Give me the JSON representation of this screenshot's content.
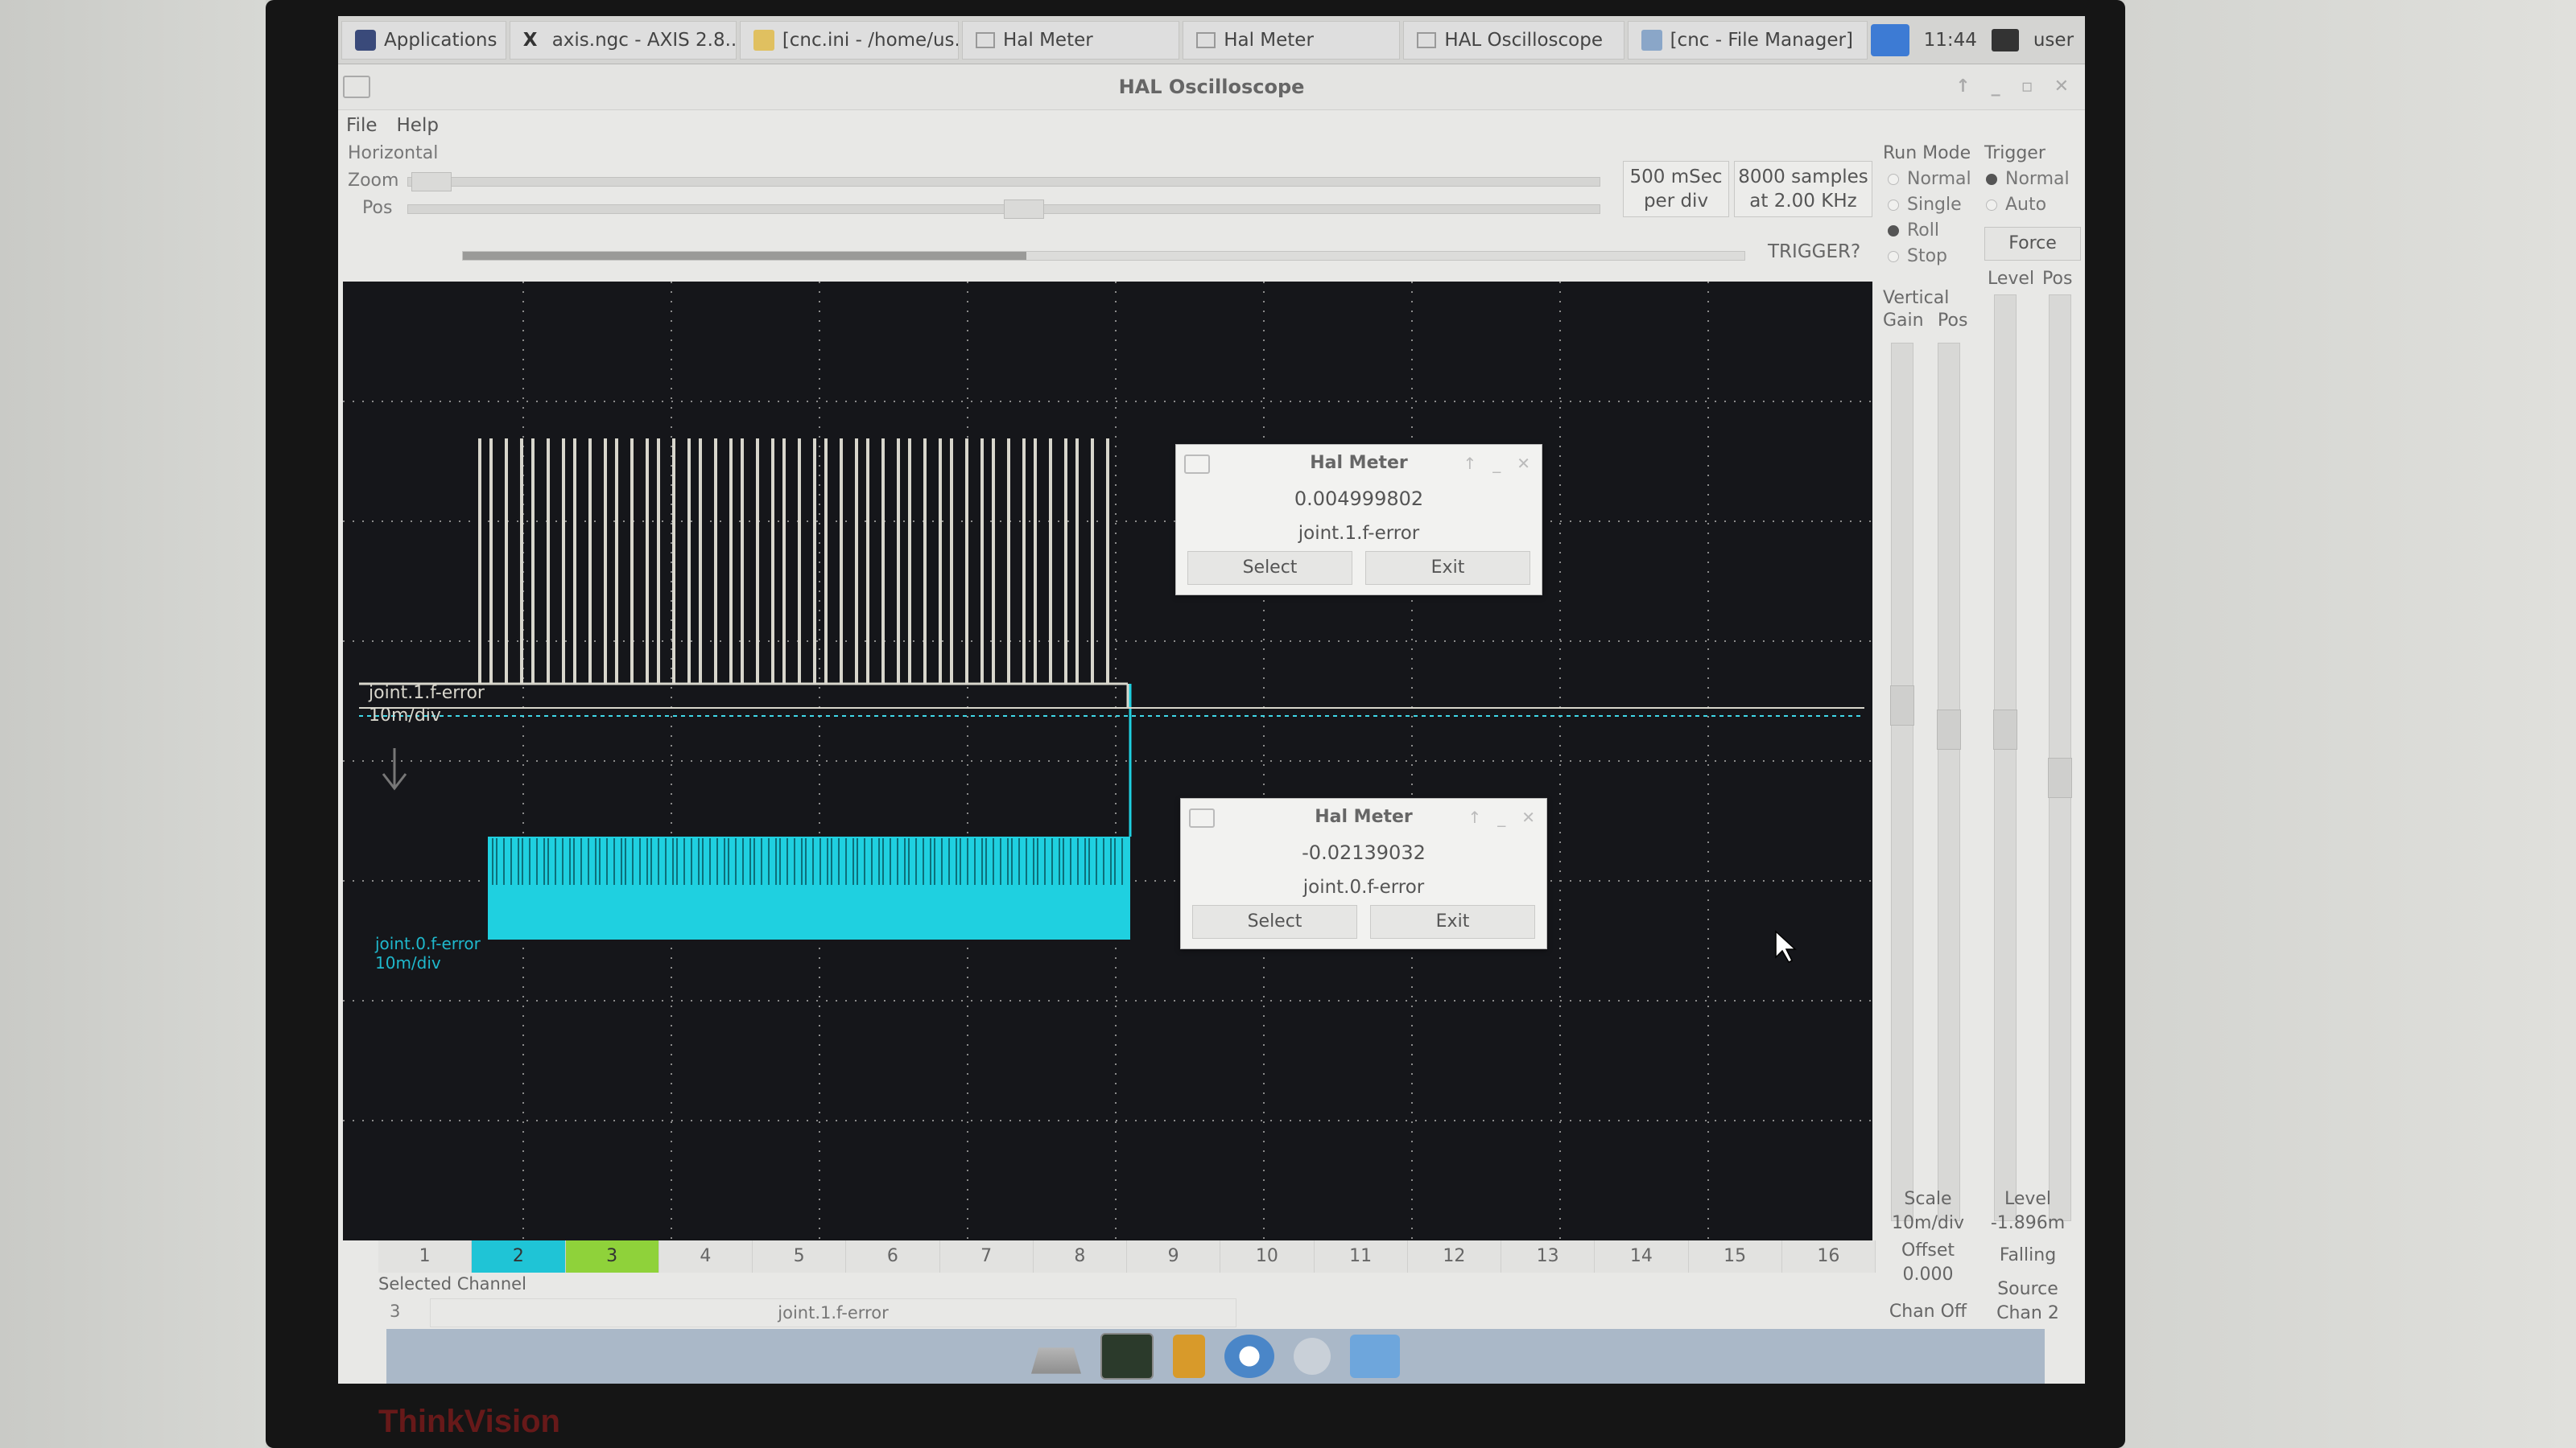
{
  "taskbar": {
    "items": [
      {
        "label": "Applications"
      },
      {
        "label": "axis.ngc - AXIS 2.8..."
      },
      {
        "label": "[cnc.ini - /home/us..."
      },
      {
        "label": "Hal Meter"
      },
      {
        "label": "Hal Meter"
      },
      {
        "label": "HAL Oscilloscope"
      },
      {
        "label": "[cnc - File Manager]"
      }
    ],
    "clock": "11:44",
    "user": "user"
  },
  "window": {
    "title": "HAL Oscilloscope",
    "menu": [
      "File",
      "Help"
    ]
  },
  "horizontal": {
    "heading": "Horizontal",
    "zoom_label": "Zoom",
    "pos_label": "Pos",
    "time_per_div": "500 mSec",
    "per_div": "per div",
    "samples": "8000 samples",
    "rate": "at 2.00 KHz",
    "trigger_status": "TRIGGER?"
  },
  "run_mode": {
    "heading": "Run Mode",
    "options": [
      {
        "label": "Normal",
        "selected": false
      },
      {
        "label": "Single",
        "selected": false
      },
      {
        "label": "Roll",
        "selected": true
      },
      {
        "label": "Stop",
        "selected": false
      }
    ]
  },
  "trigger": {
    "heading": "Trigger",
    "options": [
      {
        "label": "Normal",
        "selected": true
      },
      {
        "label": "Auto",
        "selected": false
      }
    ],
    "force_label": "Force",
    "level_label": "Level",
    "pos_label": "Pos"
  },
  "vertical": {
    "heading": "Vertical",
    "gain_label": "Gain",
    "pos_label": "Pos",
    "scale_label": "Scale",
    "scale_value": "10m/div",
    "offset_label": "Offset",
    "offset_value": "0.000",
    "chan_off_label": "Chan Off"
  },
  "trigger_info": {
    "level_label": "Level",
    "level_value": "-1.896m",
    "edge": "Falling",
    "source_label": "Source",
    "source_value": "Chan 2"
  },
  "scope": {
    "trace1_label": "joint.1.f-error",
    "trace1_scale": "10m/div",
    "trace2_label": "joint.0.f-error",
    "trace2_scale": "10m/div",
    "trace1_color": "#d8d6cc",
    "trace2_color": "#1fd0e0"
  },
  "meters": [
    {
      "title": "Hal Meter",
      "value": "0.004999802",
      "pin": "joint.1.f-error",
      "select": "Select",
      "exit": "Exit"
    },
    {
      "title": "Hal Meter",
      "value": "-0.02139032",
      "pin": "joint.0.f-error",
      "select": "Select",
      "exit": "Exit"
    }
  ],
  "channels": {
    "labels": [
      "1",
      "2",
      "3",
      "4",
      "5",
      "6",
      "7",
      "8",
      "9",
      "10",
      "11",
      "12",
      "13",
      "14",
      "15",
      "16"
    ],
    "colors": {
      "2": "#1fc4d6",
      "3": "#8fd23a"
    }
  },
  "selected_channel": {
    "label": "Selected Channel",
    "number": "3",
    "name": "joint.1.f-error"
  },
  "bezel": {
    "brand": "ThinkVision"
  }
}
